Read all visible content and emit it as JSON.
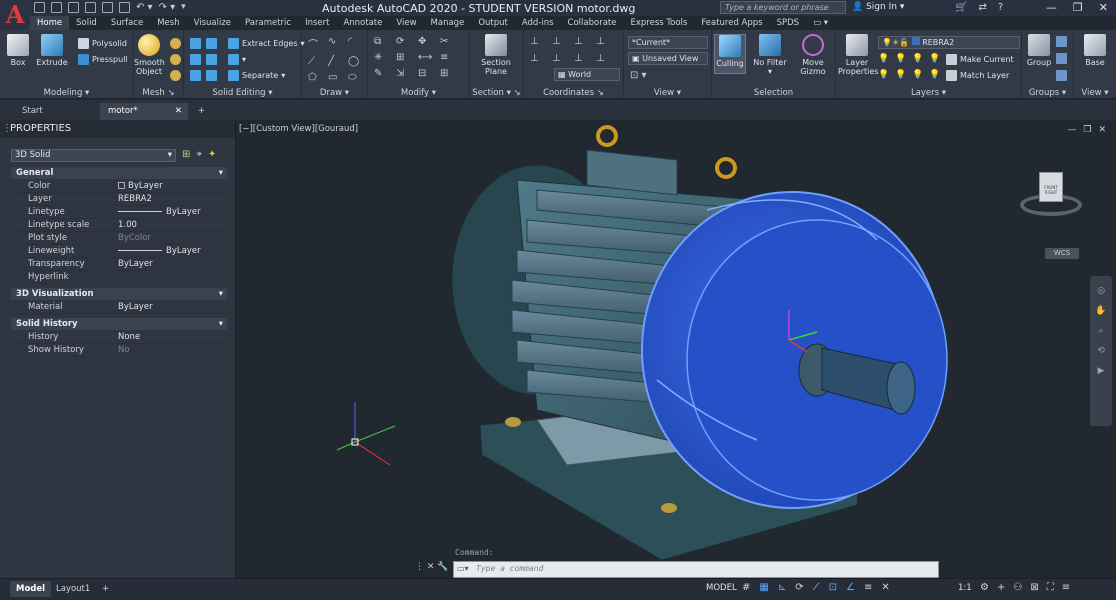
{
  "app": {
    "title": "Autodesk AutoCAD 2020 - STUDENT VERSION    motor.dwg",
    "logo": "A"
  },
  "search": {
    "placeholder": "Type a keyword or phrase"
  },
  "user": {
    "signin": "Sign In"
  },
  "ribbon_tabs": [
    "Home",
    "Solid",
    "Surface",
    "Mesh",
    "Visualize",
    "Parametric",
    "Insert",
    "Annotate",
    "View",
    "Manage",
    "Output",
    "Add-ins",
    "Collaborate",
    "Express Tools",
    "Featured Apps",
    "SPDS"
  ],
  "ribbon": {
    "modeling": {
      "title": "Modeling",
      "box": "Box",
      "extrude": "Extrude",
      "polysolid": "Polysolid",
      "presspull": "Presspull"
    },
    "mesh": {
      "title": "Mesh",
      "smooth": "Smooth Object"
    },
    "solid_editing": {
      "title": "Solid Editing",
      "extract_edges": "Extract Edges",
      "separate": "Separate"
    },
    "draw": {
      "title": "Draw"
    },
    "modify": {
      "title": "Modify"
    },
    "section": {
      "title": "Section",
      "section_plane": "Section Plane"
    },
    "coordinates": {
      "title": "Coordinates",
      "world": "World"
    },
    "view": {
      "title": "View",
      "current": "*Current*",
      "unsaved": "Unsaved View"
    },
    "selection": {
      "title": "Selection",
      "culling": "Culling",
      "no_filter": "No Filter",
      "move_gizmo": "Move Gizmo"
    },
    "layers": {
      "title": "Layers",
      "layer_properties": "Layer Properties",
      "layer_name": "REBRA2",
      "make_current": "Make Current",
      "match_layer": "Match Layer"
    },
    "groups": {
      "title": "Groups",
      "group": "Group"
    },
    "view2": {
      "title": "View",
      "base": "Base"
    }
  },
  "doc_tabs": [
    "Start",
    "motor*"
  ],
  "properties": {
    "header": "PROPERTIES",
    "selection": "3D Solid",
    "sections": [
      {
        "name": "General",
        "rows": [
          {
            "k": "Color",
            "v": "ByLayer"
          },
          {
            "k": "Layer",
            "v": "REBRA2"
          },
          {
            "k": "Linetype",
            "v": "ByLayer"
          },
          {
            "k": "Linetype scale",
            "v": "1.00"
          },
          {
            "k": "Plot style",
            "v": "ByColor"
          },
          {
            "k": "Lineweight",
            "v": "ByLayer"
          },
          {
            "k": "Transparency",
            "v": "ByLayer"
          },
          {
            "k": "Hyperlink",
            "v": ""
          }
        ]
      },
      {
        "name": "3D Visualization",
        "rows": [
          {
            "k": "Material",
            "v": "ByLayer"
          }
        ]
      },
      {
        "name": "Solid History",
        "rows": [
          {
            "k": "History",
            "v": "None"
          },
          {
            "k": "Show History",
            "v": "No"
          }
        ]
      }
    ]
  },
  "viewport": {
    "label": "[−][Custom View][Gouraud]",
    "viewcube_front": "FRONT",
    "viewcube_right": "RIGHT",
    "wcs": "WCS"
  },
  "command": {
    "label": "Command:",
    "placeholder": "Type a command"
  },
  "layout_tabs": [
    "Model",
    "Layout1"
  ],
  "status": {
    "model": "MODEL",
    "scale": "1:1"
  }
}
